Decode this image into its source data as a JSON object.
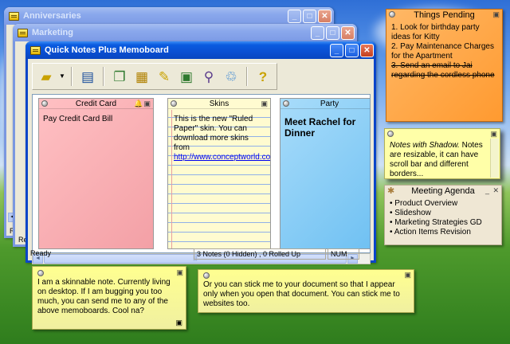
{
  "windows": {
    "anniversaries": {
      "title": "Anniversaries"
    },
    "marketing": {
      "title": "Marketing"
    },
    "main": {
      "title": "Quick Notes Plus Memoboard"
    }
  },
  "toolbar": {
    "icons": [
      "new-note-icon",
      "dropdown-caret",
      "memoboard-icon",
      "copy-notes-icon",
      "stack-notes-icon",
      "edit-note-icon",
      "rolled-up-icon",
      "find-icon",
      "recycle-bin-icon",
      "help-icon"
    ]
  },
  "notes": {
    "credit_card": {
      "title": "Credit Card",
      "body": "Pay Credit Card Bill",
      "color": "#ffb6b9"
    },
    "skins": {
      "title": "Skins",
      "body": "This is the new \"Ruled Paper\" skin. You can download more skins from",
      "link": "http://www.conceptworld.com/"
    },
    "party": {
      "title": "Party",
      "body": "Meet Rachel for Dinner",
      "color": "#8fd0f6"
    }
  },
  "statusbar": {
    "status": "Ready",
    "counts": "3 Notes (0 Hidden) , 0 Rolled Up",
    "num": "NUM"
  },
  "background_labels": {
    "anniv_re": "Re",
    "marketing_re": "Re"
  },
  "desktop_notes": {
    "things_pending": {
      "title": "Things Pending",
      "items": [
        "1. Look for birthday party ideas for Kitty",
        "2. Pay Maintenance Charges for the Apartment",
        "3. Send an email to Jai regarding the cordless phone"
      ],
      "color": "#ffa64d"
    },
    "shadow_note": {
      "emphasis": "Notes with Shadow.",
      "body": " Notes are resizable, it can have scroll bar and different borders...",
      "color": "#ffffa8"
    },
    "meeting_agenda": {
      "title": "Meeting Agenda",
      "items": [
        "Product Overview",
        "Slideshow",
        "Marketing Strategies GD",
        "Action Items Revision"
      ]
    },
    "skinnable": {
      "body": "I am a skinnable note. Currently living on desktop. If I am bugging you too much, you can send me to any of the above memoboards. Cool na?"
    },
    "stick": {
      "body": "Or you can stick me to your document so that I appear only when you open that document. You can stick me to websites too."
    }
  }
}
